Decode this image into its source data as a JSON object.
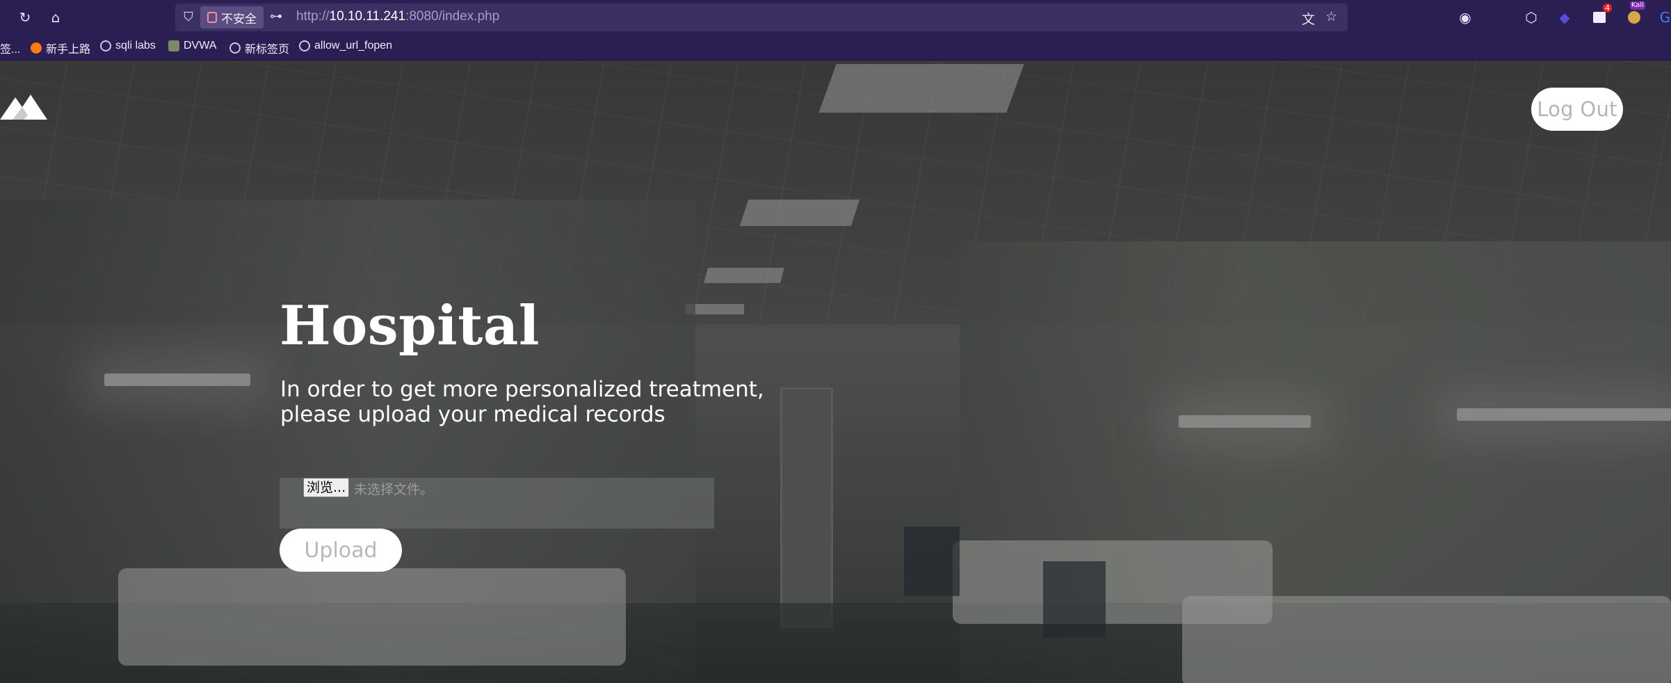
{
  "browser": {
    "security_label": "不安全",
    "url_prefix": "http://",
    "url_host": "10.10.11.241",
    "url_rest": ":8080/index.php",
    "bookmarks": [
      {
        "label": "签..."
      },
      {
        "label": "新手上路"
      },
      {
        "label": "sqli labs"
      },
      {
        "label": "DVWA"
      },
      {
        "label": "新标签页"
      },
      {
        "label": "allow_url_fopen"
      }
    ],
    "extension_badge": "4",
    "kali_tag": "Kali"
  },
  "page": {
    "logout_label": "Log Out",
    "title": "Hospital",
    "subtitle_line1": "In order to get more personalized treatment,",
    "subtitle_line2": "please upload your medical records",
    "browse_label": "浏览...",
    "no_file_label": "未选择文件。",
    "upload_label": "Upload"
  },
  "colors": {
    "chrome_bg": "#2b1e52",
    "urlbar_bg": "#3b2f63",
    "button_bg": "#ffffff",
    "button_text": "#b5b5b5"
  }
}
